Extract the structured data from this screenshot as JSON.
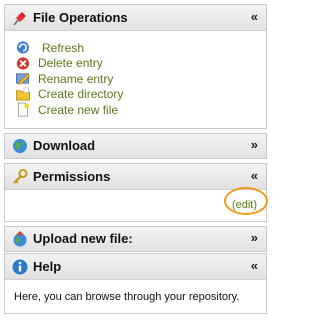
{
  "panels": {
    "file_operations": {
      "title": "File Operations",
      "toggle": "«",
      "items": [
        {
          "label": "Refresh",
          "icon": "refresh-icon"
        },
        {
          "label": "Delete entry",
          "icon": "delete-icon"
        },
        {
          "label": "Rename entry",
          "icon": "rename-icon"
        },
        {
          "label": "Create directory",
          "icon": "folder-icon"
        },
        {
          "label": "Create new file",
          "icon": "new-file-icon"
        }
      ]
    },
    "download": {
      "title": "Download",
      "toggle": "»"
    },
    "permissions": {
      "title": "Permissions",
      "toggle": "«",
      "edit_label": "(edit)"
    },
    "upload": {
      "title": "Upload new file:",
      "toggle": "»"
    },
    "help": {
      "title": "Help",
      "toggle": "«",
      "text": "Here, you can browse through your repository."
    }
  },
  "colors": {
    "link": "#5b7a12",
    "highlight_ring": "#ef9b1a"
  }
}
